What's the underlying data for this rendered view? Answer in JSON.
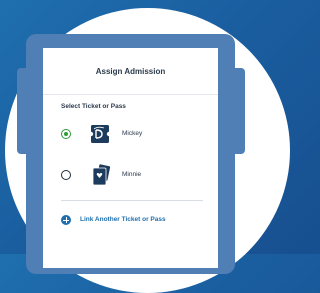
{
  "header": {
    "title": "Assign Admission"
  },
  "section": {
    "title": "Select Ticket or Pass"
  },
  "options": [
    {
      "label": "Mickey",
      "selected": true,
      "icon": "disney-ticket-icon"
    },
    {
      "label": "Minnie",
      "selected": false,
      "icon": "multi-ticket-icon"
    }
  ],
  "link": {
    "label": "Link Another Ticket or Pass",
    "icon": "plus-circle-icon"
  },
  "colors": {
    "accent": "#1f6fae",
    "selected": "#2e9a3a",
    "text": "#2b3a4b",
    "frame": "#4f7fb4"
  }
}
